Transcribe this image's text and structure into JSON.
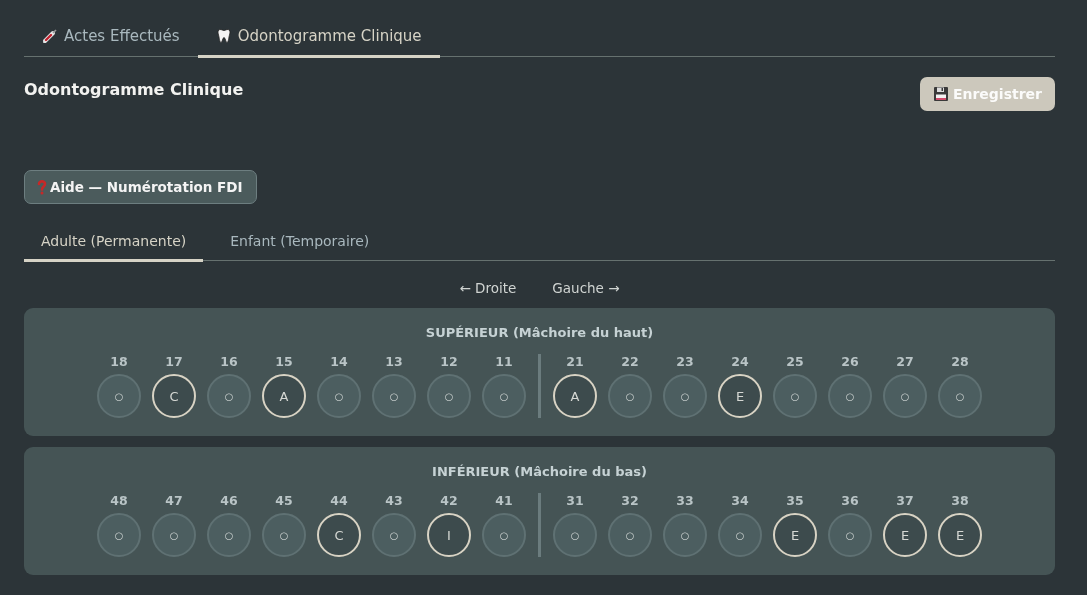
{
  "tabs": [
    {
      "label": "Actes Effectués",
      "selected": false
    },
    {
      "label": "Odontogramme Clinique",
      "selected": true
    }
  ],
  "header": {
    "title": "Odontogramme Clinique",
    "save_button": "Enregistrer"
  },
  "help_button": "Aide — Numérotation FDI",
  "dentition_tabs": [
    {
      "label": "Adulte (Permanente)",
      "selected": true
    },
    {
      "label": "Enfant (Temporaire)",
      "selected": false
    }
  ],
  "orientation": {
    "left": "← Droite",
    "right": "Gauche →"
  },
  "jaws": [
    {
      "title": "SUPÉRIEUR (Mâchoire du haut)",
      "sides": [
        [
          {
            "number": "18",
            "mark": "○",
            "marked": false
          },
          {
            "number": "17",
            "mark": "C",
            "marked": true
          },
          {
            "number": "16",
            "mark": "○",
            "marked": false
          },
          {
            "number": "15",
            "mark": "A",
            "marked": true
          },
          {
            "number": "14",
            "mark": "○",
            "marked": false
          },
          {
            "number": "13",
            "mark": "○",
            "marked": false
          },
          {
            "number": "12",
            "mark": "○",
            "marked": false
          },
          {
            "number": "11",
            "mark": "○",
            "marked": false
          }
        ],
        [
          {
            "number": "21",
            "mark": "A",
            "marked": true
          },
          {
            "number": "22",
            "mark": "○",
            "marked": false
          },
          {
            "number": "23",
            "mark": "○",
            "marked": false
          },
          {
            "number": "24",
            "mark": "E",
            "marked": true
          },
          {
            "number": "25",
            "mark": "○",
            "marked": false
          },
          {
            "number": "26",
            "mark": "○",
            "marked": false
          },
          {
            "number": "27",
            "mark": "○",
            "marked": false
          },
          {
            "number": "28",
            "mark": "○",
            "marked": false
          }
        ]
      ]
    },
    {
      "title": "INFÉRIEUR (Mâchoire du bas)",
      "sides": [
        [
          {
            "number": "48",
            "mark": "○",
            "marked": false
          },
          {
            "number": "47",
            "mark": "○",
            "marked": false
          },
          {
            "number": "46",
            "mark": "○",
            "marked": false
          },
          {
            "number": "45",
            "mark": "○",
            "marked": false
          },
          {
            "number": "44",
            "mark": "C",
            "marked": true
          },
          {
            "number": "43",
            "mark": "○",
            "marked": false
          },
          {
            "number": "42",
            "mark": "I",
            "marked": true
          },
          {
            "number": "41",
            "mark": "○",
            "marked": false
          }
        ],
        [
          {
            "number": "31",
            "mark": "○",
            "marked": false
          },
          {
            "number": "32",
            "mark": "○",
            "marked": false
          },
          {
            "number": "33",
            "mark": "○",
            "marked": false
          },
          {
            "number": "34",
            "mark": "○",
            "marked": false
          },
          {
            "number": "35",
            "mark": "E",
            "marked": true
          },
          {
            "number": "36",
            "mark": "○",
            "marked": false
          },
          {
            "number": "37",
            "mark": "E",
            "marked": true
          },
          {
            "number": "38",
            "mark": "E",
            "marked": true
          }
        ]
      ]
    }
  ]
}
